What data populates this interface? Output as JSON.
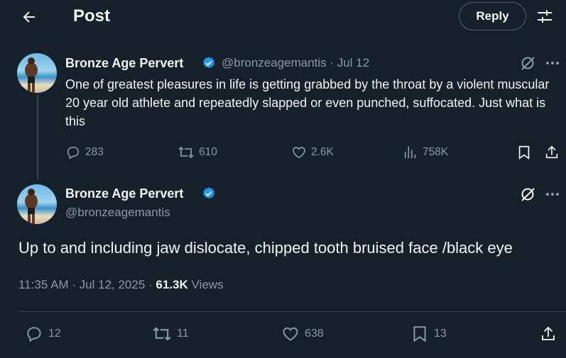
{
  "header": {
    "title": "Post",
    "reply_label": "Reply"
  },
  "parent_post": {
    "display_name": "Bronze Age Pervert",
    "handle": "@bronzeagemantis",
    "date": "· Jul 12",
    "text": "One of greatest pleasures in life is getting grabbed by the throat by a violent muscular 20 year old athlete and repeatedly slapped or even punched, suffocated. Just what is this",
    "metrics": {
      "replies": "283",
      "reposts": "610",
      "likes": "2.6K",
      "views": "758K"
    }
  },
  "main_post": {
    "display_name": "Bronze Age Pervert",
    "handle": "@bronzeagemantis",
    "text": "Up to and including jaw dislocate, chipped tooth bruised face /black eye",
    "time": "11:35 AM · Jul 12, 2025 · ",
    "views_count": "61.3K",
    "views_label": " Views",
    "metrics": {
      "replies": "12",
      "reposts": "11",
      "likes": "638",
      "bookmarks": "13"
    }
  },
  "colors": {
    "background": "#15202b",
    "text": "#f7f9f9",
    "muted": "#8b98a5",
    "verified": "#1d9bf0",
    "border": "#38444d"
  }
}
